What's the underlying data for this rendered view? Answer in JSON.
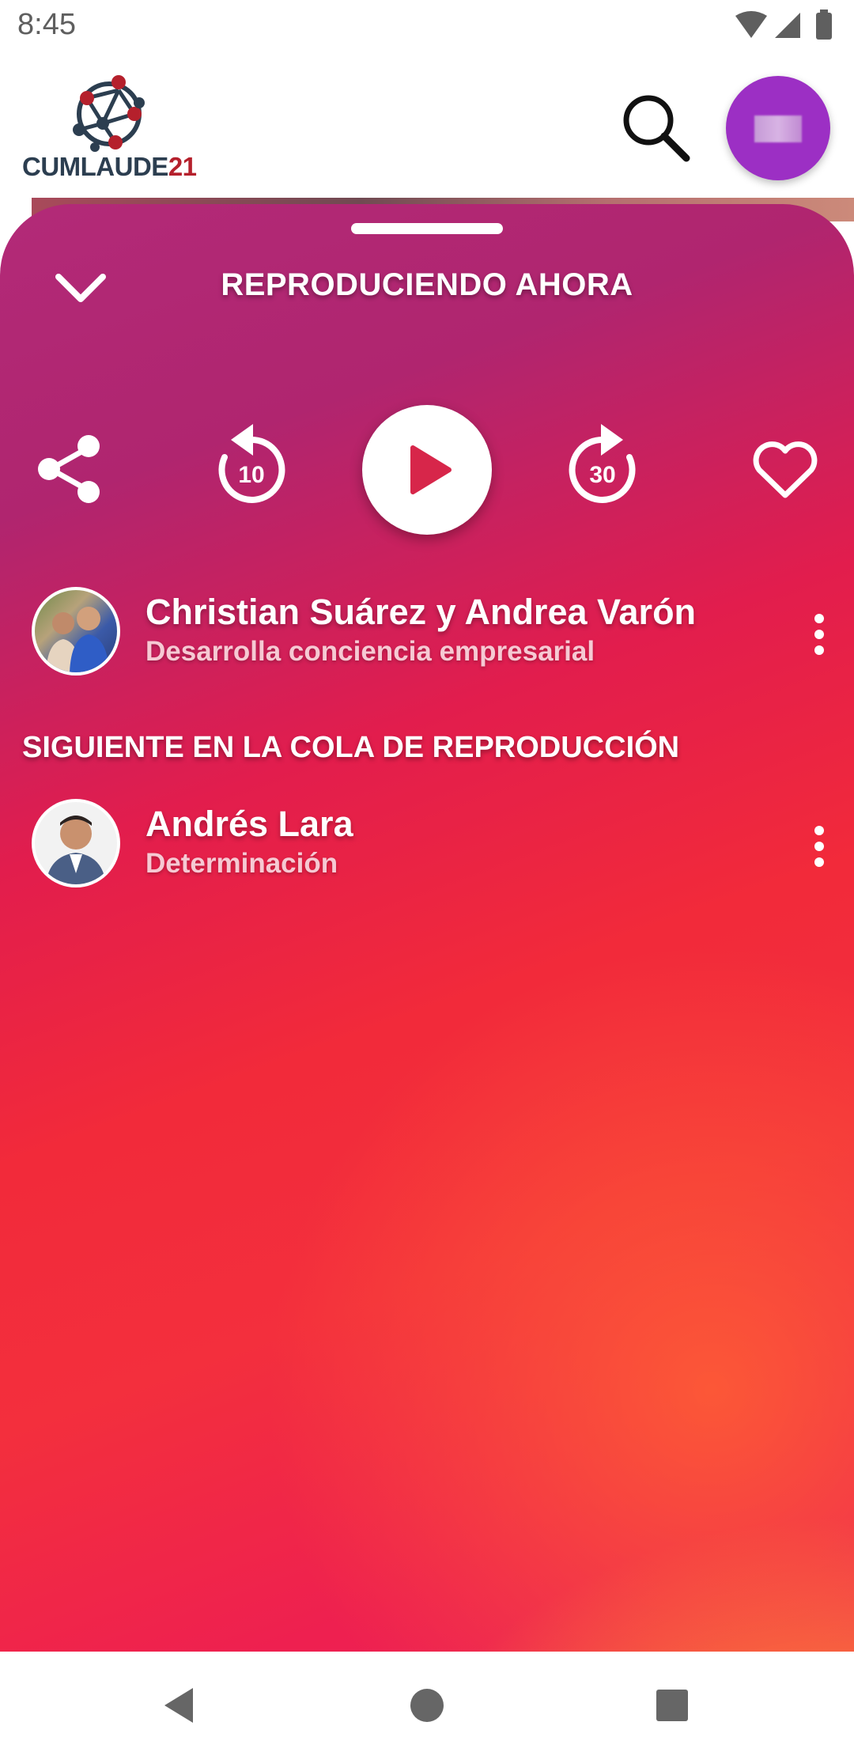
{
  "status_bar": {
    "time": "8:45"
  },
  "header": {
    "logo_text": "CUMLAUDE",
    "logo_number": "21"
  },
  "player": {
    "title": "REPRODUCIENDO AHORA",
    "rewind_seconds": "10",
    "forward_seconds": "30",
    "current_track": {
      "title": "Christian Suárez y Andrea Varón",
      "subtitle": "Desarrolla conciencia empresarial"
    },
    "queue_heading": "SIGUIENTE EN LA COLA DE REPRODUCCIÓN",
    "queue": [
      {
        "title": "Andrés Lara",
        "subtitle": "Determinación"
      }
    ]
  },
  "colors": {
    "accent": "#9c2fc4",
    "play_icon": "#d7264a",
    "gradient_top": "#b22a78",
    "gradient_mid": "#f22a3a",
    "gradient_bottom": "#ffa43a"
  }
}
